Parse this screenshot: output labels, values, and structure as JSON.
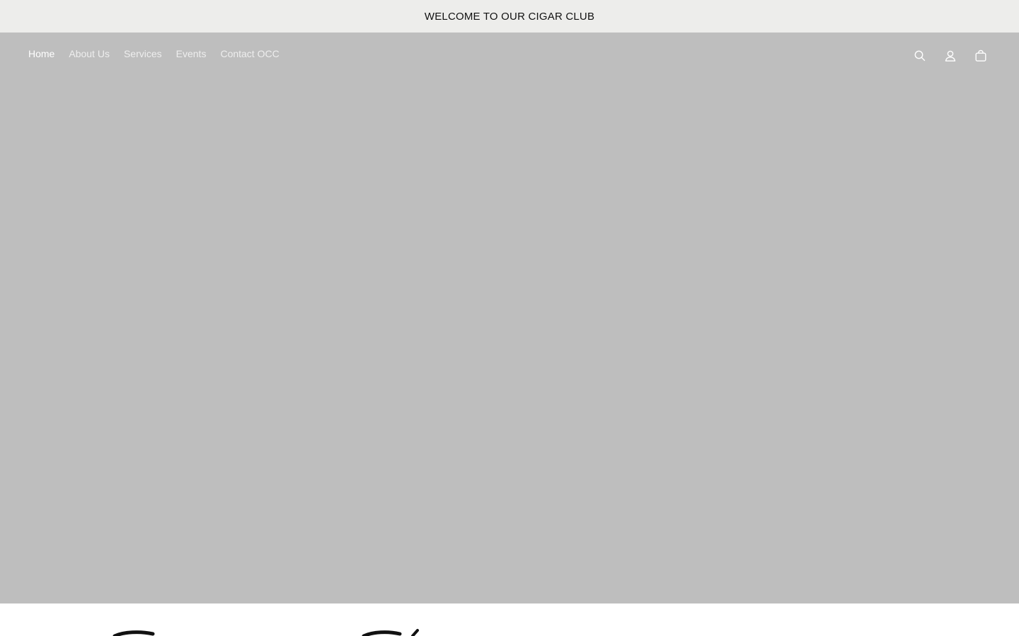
{
  "announcement": {
    "text": "WELCOME TO OUR CIGAR CLUB"
  },
  "header": {
    "nav": [
      {
        "label": "Home",
        "active": true
      },
      {
        "label": "About Us",
        "active": false
      },
      {
        "label": "Services",
        "active": false
      },
      {
        "label": "Events",
        "active": false
      },
      {
        "label": "Contact OCC",
        "active": false
      }
    ],
    "icons": [
      "search-icon",
      "account-icon",
      "cart-icon"
    ]
  },
  "colors": {
    "announcement_bg": "#ededeb",
    "hero_bg": "#bebebe",
    "nav_text": "#ffffff"
  }
}
